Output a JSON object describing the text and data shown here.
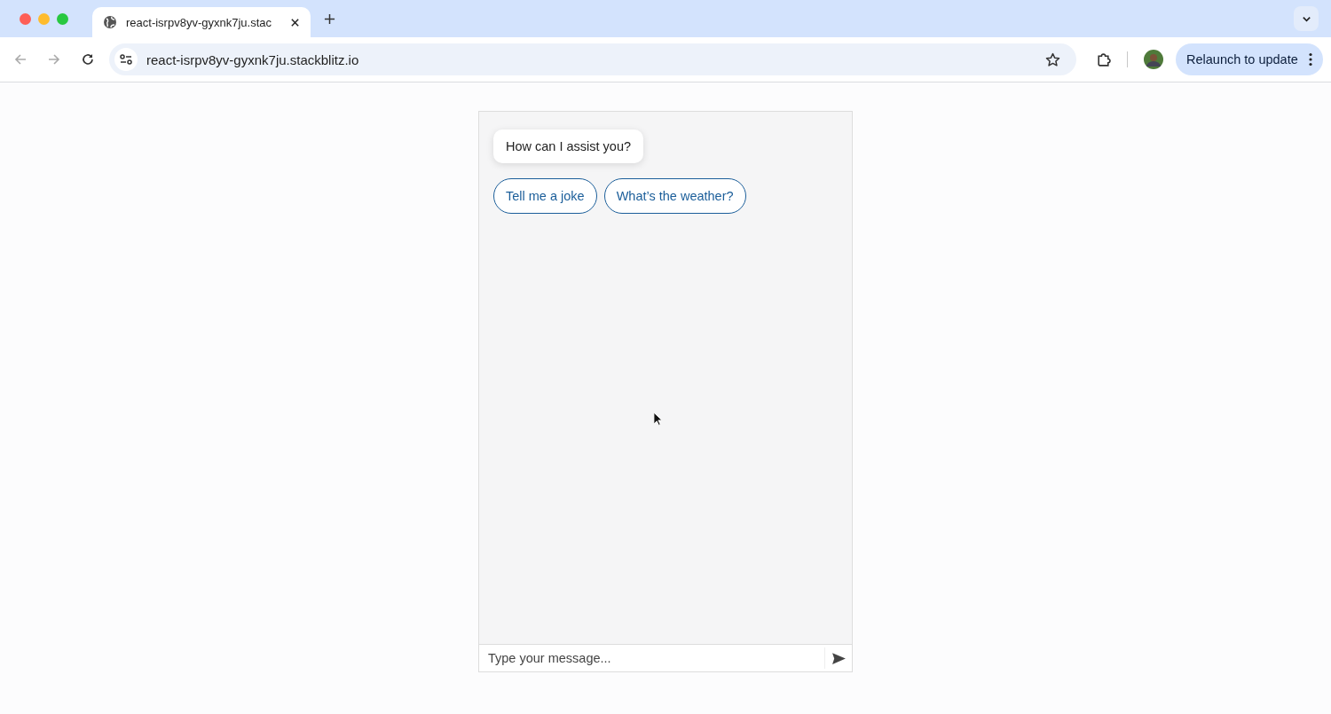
{
  "browser": {
    "tabs": [
      {
        "title": "react-isrpv8yv-gyxnk7ju.stac",
        "selected": true
      }
    ],
    "address": "react-isrpv8yv-gyxnk7ju.stackblitz.io",
    "relaunch_button": "Relaunch to update"
  },
  "chat": {
    "messages": [
      {
        "text": "How can I assist you?"
      }
    ],
    "suggestions": [
      "Tell me a joke",
      "What’s the weather?"
    ],
    "input": {
      "placeholder": "Type your message..."
    }
  }
}
